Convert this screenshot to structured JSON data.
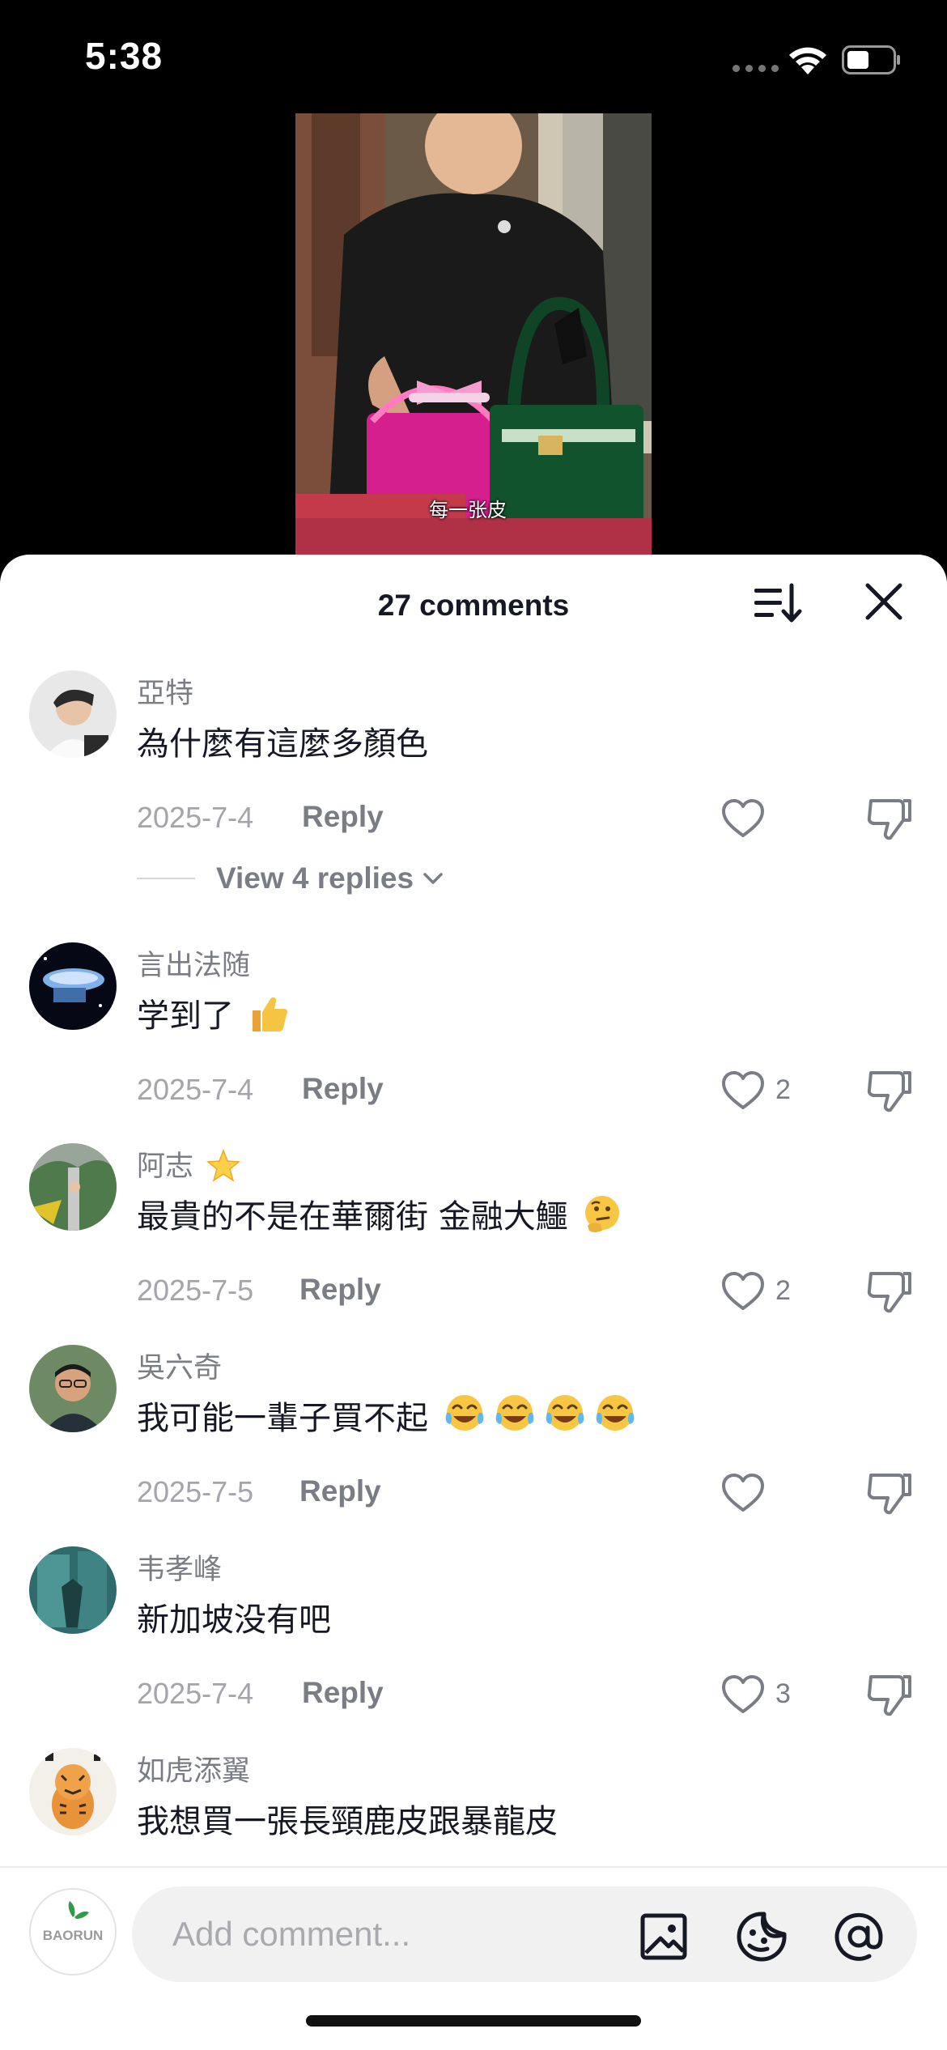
{
  "status": {
    "time": "5:38"
  },
  "video": {
    "caption": "每一张皮"
  },
  "header": {
    "title": "27 comments"
  },
  "comments": [
    {
      "user": "亞特",
      "text": "為什麼有這麼多顏色",
      "date": "2025-7-4",
      "reply_label": "Reply",
      "likes": "",
      "view_replies": "View 4 replies"
    },
    {
      "user": "言出法随",
      "text": "学到了",
      "emoji": "thumbs-up",
      "date": "2025-7-4",
      "reply_label": "Reply",
      "likes": "2"
    },
    {
      "user": "阿志",
      "user_emoji": "glowing-star",
      "text": "最貴的不是在華爾街 金融大鱷",
      "emoji": "thinking-face",
      "date": "2025-7-5",
      "reply_label": "Reply",
      "likes": "2"
    },
    {
      "user": "吳六奇",
      "text": "我可能一輩子買不起",
      "emoji": "tears-of-joy x4",
      "date": "2025-7-5",
      "reply_label": "Reply",
      "likes": ""
    },
    {
      "user": "韦孝峰",
      "text": "新加坡没有吧",
      "date": "2025-7-4",
      "reply_label": "Reply",
      "likes": "3"
    },
    {
      "user": "如虎添翼",
      "text": "我想買一張長頸鹿皮跟暴龍皮"
    }
  ],
  "input": {
    "placeholder": "Add comment...",
    "me_avatar_text": "BAORUN"
  },
  "icons": [
    "sort-icon",
    "close-icon",
    "heart-icon",
    "dislike-icon",
    "chevron-down-icon",
    "image-icon",
    "emoji-icon",
    "mention-icon",
    "wifi-icon",
    "battery-icon"
  ],
  "colors": {
    "text": "#161823",
    "muted": "#7b7d85",
    "date": "#a4a5aa",
    "input_bg": "#f1f1f2",
    "brand_green": "#2e9b47"
  }
}
